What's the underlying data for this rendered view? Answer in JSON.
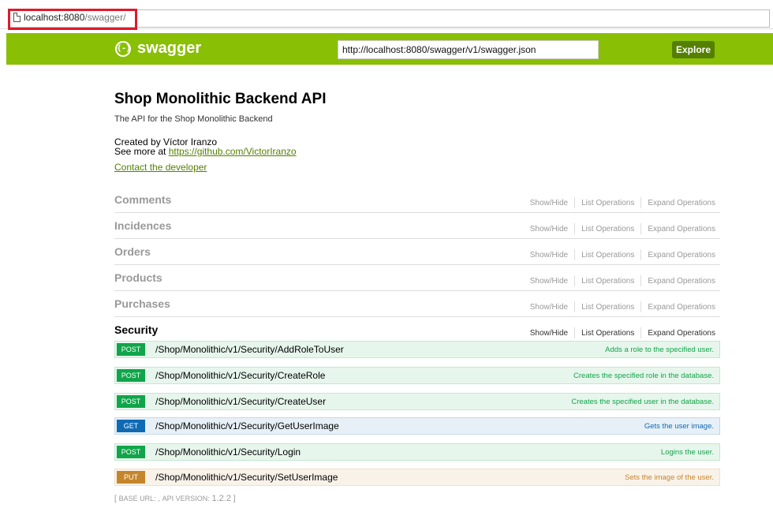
{
  "browser": {
    "url_host": "localhost:8080",
    "url_path": "/swagger/"
  },
  "header": {
    "logo_icon": "{-}",
    "logo_text": "swagger",
    "api_url": "http://localhost:8080/swagger/v1/swagger.json",
    "explore_label": "Explore",
    "bg_color": "#89bf04"
  },
  "info": {
    "title": "Shop Monolithic Backend API",
    "description": "The API for the Shop Monolithic Backend",
    "created_by": "Created by Víctor Iranzo",
    "see_more_prefix": "See more at ",
    "see_more_link": "https://github.com/VictorIranzo",
    "contact_label": "Contact the developer"
  },
  "actions": {
    "show_hide": "Show/Hide",
    "list_ops": "List Operations",
    "expand_ops": "Expand Operations"
  },
  "resources": [
    {
      "name": "Comments"
    },
    {
      "name": "Incidences"
    },
    {
      "name": "Orders"
    },
    {
      "name": "Products"
    },
    {
      "name": "Purchases"
    },
    {
      "name": "Security"
    }
  ],
  "operations": [
    {
      "verb": "POST",
      "path": "/Shop/Monolithic/v1/Security/AddRoleToUser",
      "summary": "Adds a role to the specified user."
    },
    {
      "verb": "POST",
      "path": "/Shop/Monolithic/v1/Security/CreateRole",
      "summary": "Creates the specified role in the database."
    },
    {
      "verb": "POST",
      "path": "/Shop/Monolithic/v1/Security/CreateUser",
      "summary": "Creates the specified user in the database."
    },
    {
      "verb": "GET",
      "path": "/Shop/Monolithic/v1/Security/GetUserImage",
      "summary": "Gets the user image."
    },
    {
      "verb": "POST",
      "path": "/Shop/Monolithic/v1/Security/Login",
      "summary": "Logins the user."
    },
    {
      "verb": "PUT",
      "path": "/Shop/Monolithic/v1/Security/SetUserImage",
      "summary": "Sets the image of the user."
    }
  ],
  "footer": {
    "base_url_label": "BASE URL:",
    "base_url_value": ",",
    "api_version_label": "API VERSION:",
    "api_version": "1.2.2"
  }
}
